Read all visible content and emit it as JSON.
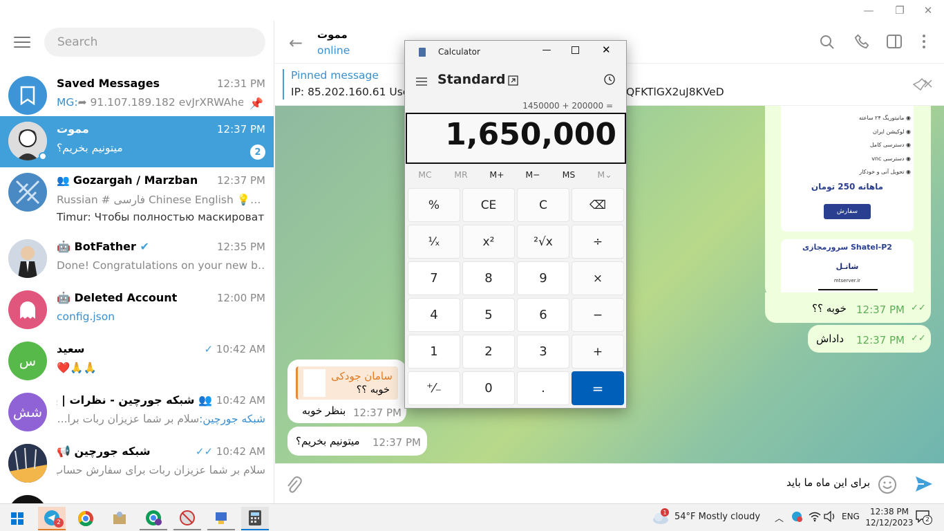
{
  "window": {
    "minimize": "—",
    "maximize": "❐",
    "close": "✕"
  },
  "sidebar": {
    "search_placeholder": "Search",
    "chats": [
      {
        "name": "Saved Messages",
        "time": "12:31 PM",
        "prefix": "MG:",
        "msg": "➦ 91.107.189.182 evJrXRWAhe…"
      },
      {
        "name": "مموت",
        "time": "12:37 PM",
        "msg": "میتونیم بخریم؟",
        "badge": "2"
      },
      {
        "name": "Gozargah / Marzban",
        "time": "12:37 PM",
        "msg": "Russian  #  فارسی  Chinese  English  💡…",
        "msg2": "Timur: Чтобы полностью маскироват…"
      },
      {
        "name": "BotFather",
        "time": "12:35 PM",
        "msg": "Done! Congratulations on your new b…"
      },
      {
        "name": "Deleted Account",
        "time": "12:00 PM",
        "msg": "config.json"
      },
      {
        "name": "سعید",
        "time": "10:42 AM",
        "msg": "❤️🙏🙏",
        "avatar": "س"
      },
      {
        "name": "شبکه جورچین - نظرات | پیشنه...",
        "time": "10:42 AM",
        "prefix": "شبکه جورچین:",
        "msg": "سلام بر شما عزیزان  ربات برا...",
        "avatar": "شش"
      },
      {
        "name": "شبکه جورچین",
        "time": "10:42 AM",
        "msg": "سلام بر شما عزیزان  ربات برای سفارش حساب آ..."
      }
    ]
  },
  "chat": {
    "title": "مموت",
    "status": "online",
    "pinned_label": "Pinned message",
    "pinned_text": "IP: 85.202.160.61 User",
    "pinned_tail": "QFKTlGX2uJ8KVeD",
    "messages": {
      "reply_name": "سامان جودکی",
      "reply_text": "خوبه ؟؟",
      "m1": "بنظر خوبه",
      "m1_time": "12:37 PM",
      "m2": "میتونیم بخریم؟",
      "m2_time": "12:37 PM",
      "o1": "خوبه ؟؟",
      "o1_time": "12:37 PM",
      "o2": "داداش",
      "o2_time": "12:37 PM"
    },
    "ad": {
      "features": [
        "مانیتوریگ ۲۴ ساعته",
        "لوکیشن ایران",
        "دسترسی کامل",
        "دسترسی vnc",
        "تحویل آنی و خودکار"
      ],
      "price": "ماهانه 250 تومان",
      "order_btn": "سفارش",
      "title2": "سرورمجازی Shatel-P2",
      "brand": "شاتـل",
      "domain": "mtserver.ir"
    },
    "composer_text": "برای این ماه ما باید"
  },
  "calculator": {
    "title": "Calculator",
    "mode": "Standard",
    "expression": "1450000 + 200000 =",
    "display": "1,650,000",
    "memory": [
      "MC",
      "MR",
      "M+",
      "M−",
      "MS",
      "M⌄"
    ],
    "keys": [
      "%",
      "CE",
      "C",
      "⌫",
      "¹⁄ₓ",
      "x²",
      "²√x",
      "÷",
      "7",
      "8",
      "9",
      "×",
      "4",
      "5",
      "6",
      "−",
      "1",
      "2",
      "3",
      "+",
      "⁺⁄₋",
      "0",
      ".",
      "="
    ]
  },
  "taskbar": {
    "weather": "54°F  Mostly cloudy",
    "weather_badge": "1",
    "lang": "ENG",
    "time": "12:38 PM",
    "date": "12/12/2023",
    "tg_badge": "2",
    "notif": "2"
  }
}
